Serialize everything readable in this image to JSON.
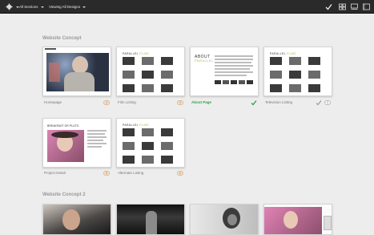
{
  "toolbar": {
    "gear_icon": "gear-icon",
    "sections_label": "All Sections",
    "designs_label": "Viewing All Designs",
    "icons": [
      "check-icon",
      "grid-view-icon",
      "filmstrip-view-icon",
      "single-view-icon"
    ]
  },
  "sections": [
    {
      "title": "Website Concept",
      "cards": [
        {
          "label": "Homepage",
          "status": "comments",
          "badge": "4"
        },
        {
          "label": "Film Listing",
          "status": "comments",
          "badge": "9"
        },
        {
          "label": "About Page",
          "status": "approved"
        },
        {
          "label": "Television Listing",
          "status": "approved-comments",
          "badge": "1"
        },
        {
          "label": "Project Detail",
          "status": "comments",
          "badge": "5"
        },
        {
          "label": "Alternate Listing",
          "status": "comments",
          "badge": "6"
        }
      ]
    },
    {
      "title": "Website Concept 2",
      "cards": []
    }
  ],
  "mini": {
    "brand_a": "PARALLEL",
    "brand_b": " FILMS",
    "about_a": "ABOUT",
    "about_b": "PARALLEL",
    "project": "BREAKFAST OR PLUTO"
  },
  "colors": {
    "approved": "#2fa24c",
    "accent": "#a6c24a",
    "badge": "#c06a20"
  }
}
